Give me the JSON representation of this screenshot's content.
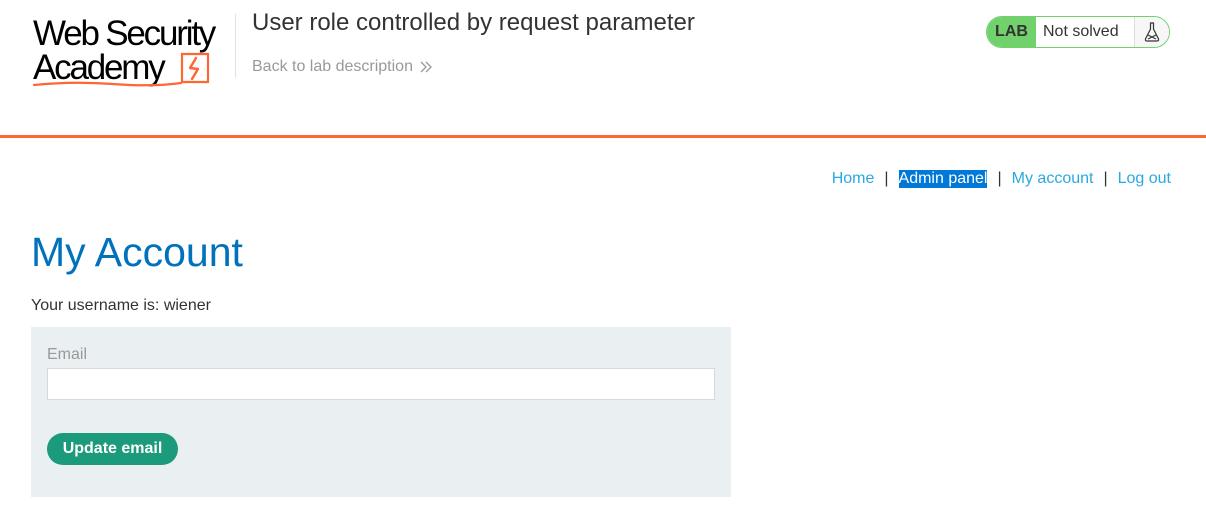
{
  "header": {
    "logo": {
      "line1": "Web Security",
      "line2": "Academy"
    },
    "lab_title": "User role controlled by request parameter",
    "back_link": "Back to lab description",
    "lab_status": {
      "badge": "LAB",
      "state": "Not solved",
      "icon": "flask-icon"
    }
  },
  "nav": {
    "items": [
      {
        "label": "Home",
        "selected": false
      },
      {
        "label": "Admin panel",
        "selected": true
      },
      {
        "label": "My account",
        "selected": false
      },
      {
        "label": "Log out",
        "selected": false
      }
    ],
    "separator": "|"
  },
  "main": {
    "title": "My Account",
    "username_line": "Your username is: wiener",
    "email_form": {
      "label": "Email",
      "value": "",
      "button": "Update email"
    }
  },
  "colors": {
    "accent_orange": "#ff6633",
    "title_blue": "#0071bc",
    "link_blue": "#29a9e1",
    "lab_green": "#70d16d",
    "button_green": "#1c9a7c",
    "form_bg": "#eaeff2"
  }
}
